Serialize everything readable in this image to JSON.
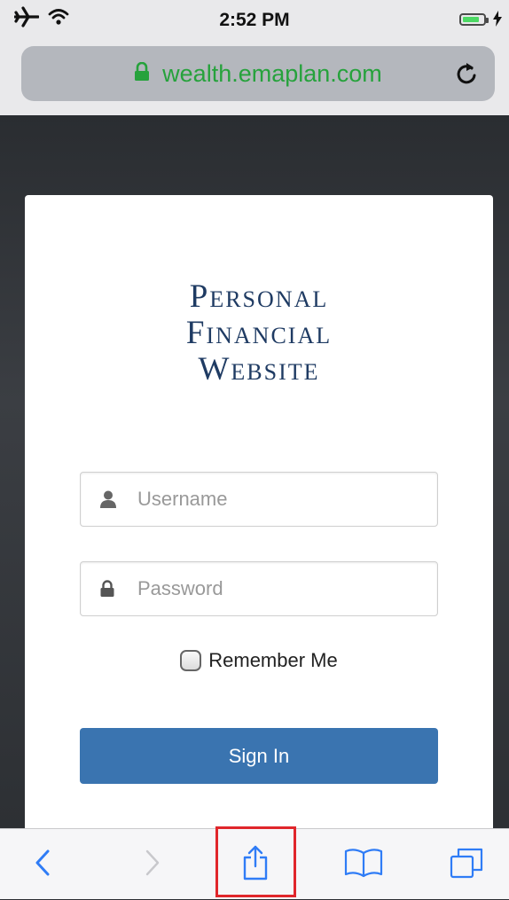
{
  "status_bar": {
    "time": "2:52 PM"
  },
  "browser": {
    "url": "wealth.emaplan.com"
  },
  "login": {
    "title_lines": [
      "Personal",
      "Financial",
      "Website"
    ],
    "username_placeholder": "Username",
    "password_placeholder": "Password",
    "remember_label": "Remember Me",
    "signin_label": "Sign In"
  },
  "colors": {
    "url_text": "#26a23c",
    "brand_title": "#1f3b63",
    "signin_button": "#3a74b0",
    "toolbar_icons": "#2f7cf6",
    "highlight_box": "#e0262b"
  },
  "icons": {
    "status": [
      "airplane-icon",
      "wifi-icon",
      "battery-icon",
      "charging-bolt-icon"
    ],
    "browser": [
      "lock-icon",
      "reload-icon"
    ],
    "fields": [
      "user-icon",
      "lock-icon"
    ],
    "toolbar": [
      "back-chevron-icon",
      "forward-chevron-icon",
      "share-icon",
      "bookmarks-icon",
      "tabs-icon"
    ]
  }
}
